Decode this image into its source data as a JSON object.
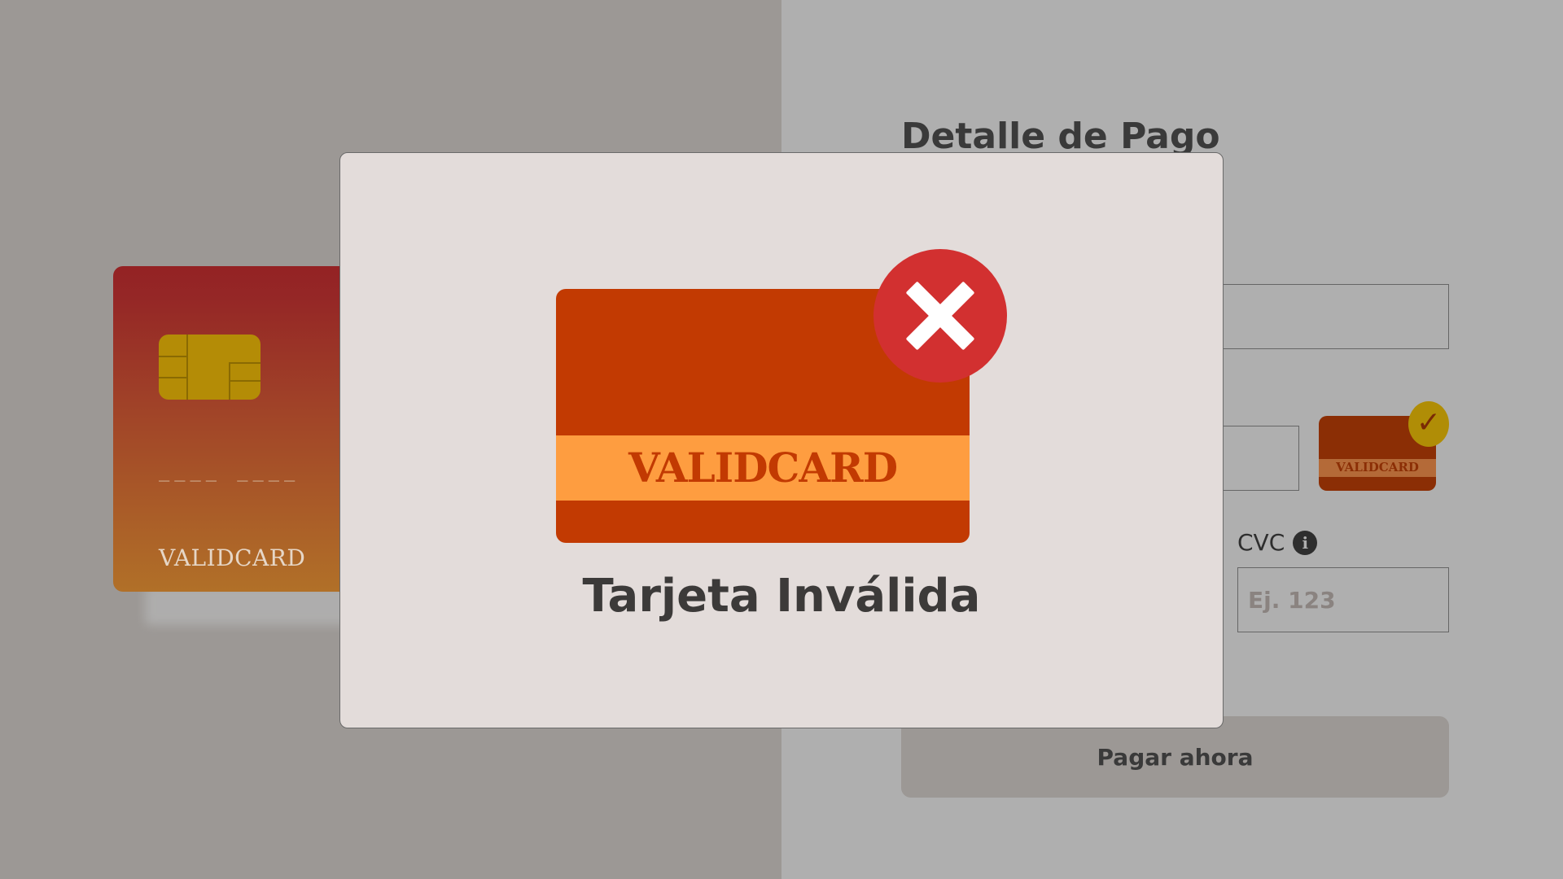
{
  "background": {
    "card_preview": {
      "number_placeholder": "____  ____",
      "brand": "VALIDCARD"
    },
    "form": {
      "title": "Detalle de Pago",
      "cvc_label": "CVC",
      "cvc_placeholder": "Ej. 123",
      "card_brand_badge": "VALIDCARD",
      "pay_button_label": "Pagar ahora"
    }
  },
  "modal": {
    "card_brand": "VALIDCARD",
    "title": "Tarjeta Inválida",
    "icon": "close-icon"
  },
  "colors": {
    "modal_bg": "#e3dcda",
    "error_red": "#d23030",
    "card_orange": "#c23a02",
    "card_band": "#fe9d40"
  }
}
